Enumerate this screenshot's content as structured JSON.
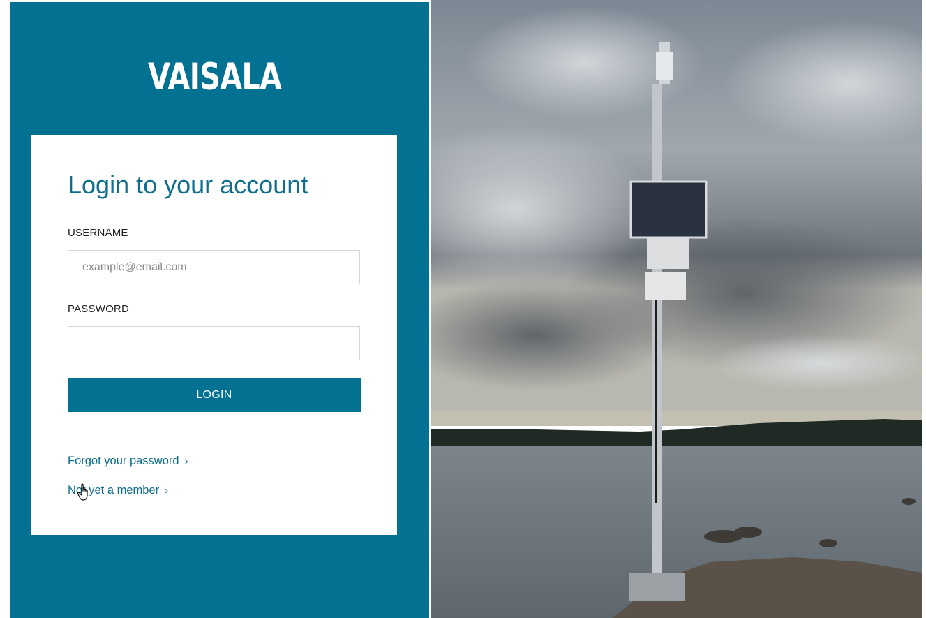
{
  "brand": {
    "logo_text": "VAISALA",
    "color": "#037292"
  },
  "login": {
    "title": "Login to your account",
    "username_label": "USERNAME",
    "username_placeholder": "example@email.com",
    "username_value": "",
    "password_label": "PASSWORD",
    "password_value": "",
    "login_button": "LOGIN",
    "forgot_link": "Forgot your password",
    "member_link": "Not yet a member",
    "link_chevron": "›"
  },
  "icons": {
    "cursor": "hand-pointer-icon"
  },
  "photo": {
    "subject": "weather-station-mast-by-sea"
  }
}
